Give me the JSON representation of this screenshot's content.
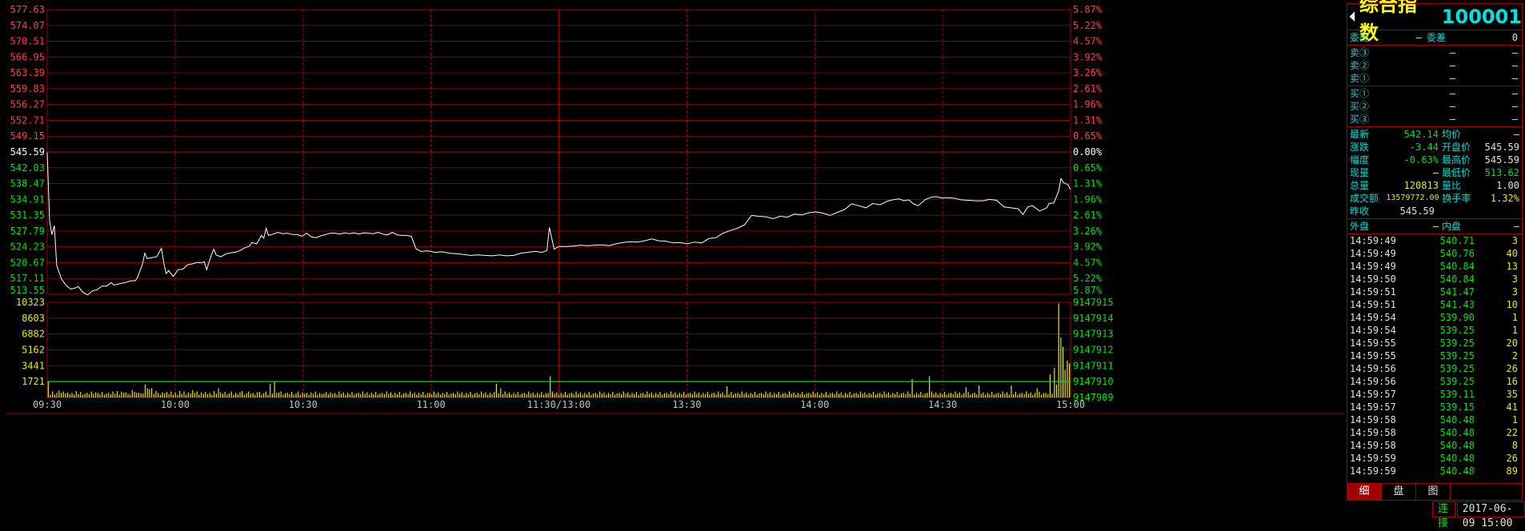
{
  "panel": {
    "name": "综合指数",
    "code": "100001",
    "ratio": {
      "label1": "委比",
      "value1": "—",
      "label2": "委差",
      "value2": "0"
    },
    "sell": [
      {
        "label": "卖③",
        "price": "—",
        "vol": "—"
      },
      {
        "label": "卖②",
        "price": "—",
        "vol": "—"
      },
      {
        "label": "卖①",
        "price": "—",
        "vol": "—"
      }
    ],
    "buy": [
      {
        "label": "买①",
        "price": "—",
        "vol": "—"
      },
      {
        "label": "买②",
        "price": "—",
        "vol": "—"
      },
      {
        "label": "买③",
        "price": "—",
        "vol": "—"
      }
    ],
    "stats": [
      {
        "l1": "最新",
        "v1": "542.14",
        "l2": "均价",
        "v2": "—"
      },
      {
        "l1": "涨跌",
        "v1": "-3.44",
        "l2": "开盘价",
        "v2": "545.59"
      },
      {
        "l1": "幅度",
        "v1": "-0.63%",
        "l2": "最高价",
        "v2": "545.59"
      },
      {
        "l1": "现量",
        "v1": "—",
        "l2": "最低价",
        "v2": "513.62"
      },
      {
        "l1": "总量",
        "v1": "120813",
        "l2": "量比",
        "v2": "1.00"
      },
      {
        "l1": "成交额",
        "v1": "13579772.00",
        "l2": "换手率",
        "v2": "1.32%"
      },
      {
        "l1": "昨收",
        "v1": "545.59",
        "l2": "",
        "v2": ""
      }
    ],
    "outer_inner": {
      "l1": "外盘",
      "v1": "—",
      "l2": "内盘",
      "v2": "—"
    },
    "ticks": [
      {
        "time": "14:59:49",
        "price": "540.71",
        "vol": "3"
      },
      {
        "time": "14:59:49",
        "price": "540.76",
        "vol": "40"
      },
      {
        "time": "14:59:49",
        "price": "540.84",
        "vol": "13"
      },
      {
        "time": "14:59:50",
        "price": "540.84",
        "vol": "3"
      },
      {
        "time": "14:59:51",
        "price": "541.47",
        "vol": "3"
      },
      {
        "time": "14:59:51",
        "price": "541.43",
        "vol": "10"
      },
      {
        "time": "14:59:54",
        "price": "539.90",
        "vol": "1"
      },
      {
        "time": "14:59:54",
        "price": "539.25",
        "vol": "1"
      },
      {
        "time": "14:59:55",
        "price": "539.25",
        "vol": "20"
      },
      {
        "time": "14:59:55",
        "price": "539.25",
        "vol": "2"
      },
      {
        "time": "14:59:56",
        "price": "539.25",
        "vol": "26"
      },
      {
        "time": "14:59:56",
        "price": "539.25",
        "vol": "16"
      },
      {
        "time": "14:59:57",
        "price": "539.11",
        "vol": "35"
      },
      {
        "time": "14:59:57",
        "price": "539.15",
        "vol": "41"
      },
      {
        "time": "14:59:58",
        "price": "540.48",
        "vol": "1"
      },
      {
        "time": "14:59:58",
        "price": "540.48",
        "vol": "22"
      },
      {
        "time": "14:59:58",
        "price": "540.48",
        "vol": "8"
      },
      {
        "time": "14:59:59",
        "price": "540.48",
        "vol": "26"
      },
      {
        "time": "14:59:59",
        "price": "540.48",
        "vol": "89"
      }
    ],
    "tabs": [
      "细",
      "盘",
      "图"
    ]
  },
  "status": {
    "connection": "连接",
    "datetime": "2017-06-09 15:00"
  },
  "colors": {
    "grid": "#a00000",
    "up": "#ff4040",
    "down": "#00e000",
    "line": "#ffffff",
    "volume": "#e8e800",
    "volume_avg": "#00e000",
    "prev_close": "#ffffff"
  },
  "chart_data": {
    "type": "line",
    "prev_close": 545.59,
    "price_axis": {
      "ylim": [
        513.55,
        577.63
      ],
      "left_ticks": [
        "577.63",
        "574.07",
        "570.51",
        "566.95",
        "563.39",
        "559.83",
        "556.27",
        "552.71",
        "549.15",
        "545.59",
        "542.03",
        "538.47",
        "534.91",
        "531.35",
        "527.79",
        "524.23",
        "520.67",
        "517.11",
        "513.55"
      ],
      "right_ticks": [
        "5.87%",
        "5.22%",
        "4.57%",
        "3.92%",
        "3.26%",
        "2.61%",
        "1.96%",
        "1.31%",
        "0.65%",
        "0.00%",
        "0.65%",
        "1.31%",
        "1.96%",
        "2.61%",
        "3.26%",
        "3.92%",
        "4.57%",
        "5.22%",
        "5.87%"
      ]
    },
    "volume_axis": {
      "left_ticks": [
        "10323",
        "8603",
        "6882",
        "5162",
        "3441",
        "1721"
      ],
      "right_ticks": [
        "9147915",
        "9147914",
        "9147913",
        "9147912",
        "9147911",
        "9147910",
        "9147909"
      ]
    },
    "x_ticks": [
      "09:30",
      "10:00",
      "10:30",
      "11:00",
      "11:30/13:00",
      "13:30",
      "14:00",
      "14:30",
      "15:00"
    ],
    "minutes_total": 240,
    "price_series": [
      [
        0,
        545.5
      ],
      [
        1,
        530
      ],
      [
        2,
        527
      ],
      [
        3,
        529
      ],
      [
        4,
        520
      ],
      [
        6,
        517
      ],
      [
        8,
        515.5
      ],
      [
        10,
        514.7
      ],
      [
        12,
        515
      ],
      [
        13,
        515.3
      ],
      [
        15,
        514
      ],
      [
        17,
        513.4
      ],
      [
        19,
        514.3
      ],
      [
        21,
        514.6
      ],
      [
        23,
        515.4
      ],
      [
        25,
        515.4
      ],
      [
        27,
        516.2
      ],
      [
        28,
        515.6
      ],
      [
        31,
        516
      ],
      [
        33,
        516.2
      ],
      [
        35,
        516.6
      ],
      [
        37,
        516.6
      ],
      [
        38,
        517.4
      ],
      [
        40,
        520.3
      ],
      [
        41,
        522.8
      ],
      [
        42,
        521.6
      ],
      [
        44,
        521.8
      ],
      [
        46,
        522
      ],
      [
        48,
        523.9
      ],
      [
        49,
        520.6
      ],
      [
        50,
        518.2
      ],
      [
        51,
        518.9
      ],
      [
        53,
        517.6
      ],
      [
        55,
        519.1
      ],
      [
        57,
        519.2
      ],
      [
        59,
        520.2
      ],
      [
        61,
        520.4
      ],
      [
        63,
        520.7
      ],
      [
        65,
        520.6
      ],
      [
        66,
        520.9
      ],
      [
        67,
        519.1
      ],
      [
        69,
        522.4
      ],
      [
        70,
        523.7
      ],
      [
        71,
        522.4
      ],
      [
        73,
        522
      ],
      [
        75,
        522.6
      ],
      [
        77,
        522.9
      ],
      [
        79,
        523
      ],
      [
        81,
        523.4
      ],
      [
        83,
        524
      ],
      [
        85,
        524.4
      ],
      [
        86,
        525.2
      ],
      [
        88,
        524.9
      ],
      [
        89,
        525.8
      ],
      [
        90,
        526.8
      ],
      [
        91,
        526.2
      ],
      [
        92,
        528.4
      ],
      [
        93,
        526.8
      ],
      [
        95,
        527.1
      ],
      [
        97,
        527.5
      ],
      [
        99,
        527.2
      ],
      [
        101,
        527.3
      ],
      [
        103,
        527
      ],
      [
        105,
        527
      ],
      [
        107,
        526.6
      ],
      [
        109,
        527.3
      ],
      [
        111,
        526.5
      ],
      [
        113,
        526.3
      ],
      [
        115,
        526.7
      ],
      [
        117,
        527
      ],
      [
        119,
        527.3
      ],
      [
        121,
        527.3
      ],
      [
        123,
        527.1
      ],
      [
        125,
        527.4
      ],
      [
        127,
        527.2
      ],
      [
        129,
        527.4
      ],
      [
        131,
        527.1
      ],
      [
        133,
        527.4
      ],
      [
        135,
        527.3
      ],
      [
        137,
        527.2
      ],
      [
        139,
        527.5
      ],
      [
        141,
        527.1
      ],
      [
        143,
        526.9
      ],
      [
        145,
        527.5
      ],
      [
        147,
        526.9
      ],
      [
        149,
        526.8
      ],
      [
        151,
        526.8
      ],
      [
        153,
        526.6
      ],
      [
        155,
        523.8
      ],
      [
        157,
        523.2
      ],
      [
        160,
        523.3
      ],
      [
        163,
        523
      ],
      [
        166,
        523.1
      ],
      [
        169,
        522.8
      ],
      [
        172,
        522.7
      ],
      [
        175,
        522.5
      ],
      [
        178,
        522.3
      ],
      [
        181,
        522.4
      ],
      [
        184,
        522.3
      ],
      [
        187,
        522.2
      ],
      [
        190,
        522.4
      ],
      [
        193,
        522.2
      ],
      [
        196,
        522.3
      ],
      [
        199,
        522.8
      ],
      [
        202,
        523
      ],
      [
        205,
        523.2
      ],
      [
        208,
        523
      ],
      [
        210,
        523.4
      ],
      [
        211,
        528.6
      ],
      [
        213,
        523.7
      ],
      [
        215,
        524.3
      ],
      [
        218,
        524.3
      ],
      [
        221,
        524.4
      ],
      [
        224,
        524.6
      ],
      [
        227,
        524.5
      ],
      [
        230,
        524.6
      ],
      [
        233,
        524.7
      ],
      [
        236,
        524.5
      ],
      [
        239,
        524.9
      ],
      [
        242,
        525.2
      ],
      [
        245,
        525.4
      ],
      [
        248,
        525.3
      ],
      [
        251,
        525.6
      ],
      [
        254,
        526
      ],
      [
        257,
        525.6
      ],
      [
        260,
        525.5
      ],
      [
        263,
        525.1
      ],
      [
        266,
        525.2
      ],
      [
        269,
        524.9
      ],
      [
        272,
        525.3
      ],
      [
        275,
        525.1
      ],
      [
        278,
        526.1
      ],
      [
        281,
        526.3
      ],
      [
        284,
        527.3
      ],
      [
        287,
        527.9
      ],
      [
        290,
        528.4
      ],
      [
        293,
        529.2
      ],
      [
        296,
        531.3
      ],
      [
        299,
        531.1
      ],
      [
        302,
        531
      ],
      [
        305,
        530.6
      ],
      [
        308,
        531.1
      ],
      [
        311,
        530.9
      ],
      [
        314,
        531.6
      ],
      [
        317,
        531.4
      ],
      [
        320,
        531.9
      ],
      [
        323,
        532.1
      ],
      [
        326,
        531.8
      ],
      [
        329,
        531.3
      ],
      [
        332,
        532
      ],
      [
        335,
        532.6
      ],
      [
        338,
        533.9
      ],
      [
        341,
        533.5
      ],
      [
        344,
        533
      ],
      [
        347,
        534
      ],
      [
        350,
        533.7
      ],
      [
        353,
        534.5
      ],
      [
        356,
        534.9
      ],
      [
        358,
        535
      ],
      [
        360,
        534.6
      ],
      [
        362,
        534.8
      ],
      [
        364,
        533.9
      ],
      [
        366,
        533.5
      ],
      [
        369,
        534.9
      ],
      [
        372,
        535.5
      ],
      [
        374,
        535.5
      ],
      [
        376,
        535.2
      ],
      [
        378,
        535.3
      ],
      [
        381,
        535.2
      ],
      [
        384,
        534.8
      ],
      [
        387,
        534.7
      ],
      [
        390,
        534.6
      ],
      [
        393,
        534.6
      ],
      [
        396,
        534.9
      ],
      [
        399,
        534.7
      ],
      [
        402,
        533.2
      ],
      [
        405,
        533
      ],
      [
        408,
        532.8
      ],
      [
        410,
        531.5
      ],
      [
        412,
        533.2
      ],
      [
        414,
        533.5
      ],
      [
        417,
        532.3
      ],
      [
        420,
        533
      ],
      [
        421,
        534
      ],
      [
        423,
        534.1
      ],
      [
        425,
        536.8
      ],
      [
        426,
        539.6
      ],
      [
        427,
        538.7
      ],
      [
        429,
        538.2
      ],
      [
        430,
        537.1
      ]
    ],
    "volume_series": {
      "ylim": [
        0,
        10323
      ],
      "avg_level": 1721,
      "values": [
        1721,
        300,
        650,
        300,
        500,
        750,
        500,
        650,
        450,
        550,
        350,
        500,
        300,
        700,
        350,
        600,
        300,
        400,
        500,
        350,
        650,
        400,
        550,
        500,
        350,
        600,
        300,
        450,
        500,
        350,
        650,
        400,
        700,
        300,
        650,
        500,
        550,
        400,
        300,
        800,
        600,
        500,
        500,
        450,
        450,
        1400,
        1000,
        900,
        1000,
        400,
        700,
        500,
        300,
        550,
        450,
        600,
        350,
        650,
        300,
        550,
        300,
        700,
        400,
        650,
        300,
        550,
        450,
        800,
        500,
        650,
        300,
        550,
        400,
        600,
        350,
        500,
        300,
        700,
        400,
        1000,
        550,
        400,
        600,
        350,
        450,
        650,
        300,
        500,
        350,
        550,
        700,
        300,
        450,
        650,
        400,
        500,
        300,
        550,
        600,
        300,
        450,
        650,
        300,
        1500,
        400,
        1700,
        500,
        550,
        650,
        300,
        450,
        500,
        350,
        600,
        300,
        450,
        650,
        300,
        550,
        400,
        500,
        300,
        550,
        400,
        650,
        300,
        500,
        350,
        450,
        600,
        350,
        550,
        400,
        500,
        300,
        650,
        400,
        550,
        300,
        500,
        350,
        600,
        300,
        450,
        500,
        350,
        650,
        400,
        550,
        300,
        500,
        350,
        600,
        300,
        450,
        500,
        350,
        650,
        400,
        550,
        300,
        500,
        350,
        600,
        300,
        450,
        500,
        350,
        650,
        400,
        550,
        300,
        500,
        350,
        600,
        300,
        450,
        500,
        350,
        650,
        400,
        550,
        300,
        500,
        350,
        600,
        300,
        450,
        500,
        350,
        650,
        400,
        550,
        300,
        500,
        350,
        600,
        300,
        450,
        500,
        350,
        650,
        400,
        550,
        300,
        500,
        350,
        600,
        1500,
        450,
        1000,
        350,
        650,
        400,
        550,
        300,
        500,
        350,
        600,
        300,
        450,
        500,
        350,
        650,
        400,
        550,
        300,
        500,
        350,
        600,
        300,
        450,
        500,
        2300,
        650,
        400,
        550,
        300,
        500,
        350,
        600,
        300,
        450,
        500,
        350,
        650,
        400,
        550,
        300,
        500,
        350,
        600,
        300,
        450,
        500,
        350,
        650,
        400,
        550,
        300,
        500,
        350,
        600,
        300,
        450,
        500,
        350,
        650,
        400,
        550,
        300,
        500,
        350,
        600,
        300,
        450,
        500,
        350,
        650,
        400,
        550,
        300,
        500,
        350,
        600,
        300,
        450,
        500,
        350,
        650,
        400,
        550,
        300,
        500,
        350,
        600,
        300,
        450,
        500,
        350,
        650,
        400,
        550,
        300,
        500,
        350,
        600,
        300,
        450,
        500,
        350,
        650,
        400,
        550,
        300,
        1200,
        350,
        600,
        300,
        450,
        500,
        350,
        650,
        400,
        550,
        300,
        500,
        350,
        600,
        300,
        450,
        500,
        350,
        650,
        400,
        550,
        300,
        500,
        350,
        600,
        300,
        450,
        500,
        350,
        650,
        400,
        550,
        300,
        500,
        350,
        600,
        300,
        450,
        500,
        350,
        650,
        400,
        550,
        300,
        500,
        350,
        600,
        300,
        450,
        500,
        350,
        650,
        400,
        550,
        300,
        500,
        350,
        600,
        300,
        450,
        500,
        350,
        650,
        400,
        550,
        300,
        500,
        350,
        600,
        300,
        450,
        500,
        350,
        650,
        400,
        550,
        300,
        500,
        350,
        600,
        300,
        450,
        500,
        350,
        650,
        400,
        2000,
        300,
        500,
        350,
        600,
        300,
        450,
        500,
        2300,
        650,
        400,
        550,
        300,
        500,
        350,
        600,
        300,
        450,
        500,
        350,
        650,
        400,
        550,
        300,
        500,
        1100,
        600,
        300,
        450,
        500,
        350,
        1300,
        400,
        550,
        300,
        500,
        350,
        600,
        300,
        450,
        500,
        350,
        650,
        400,
        550,
        300,
        1300,
        350,
        600,
        300,
        450,
        500,
        350,
        650,
        400,
        550,
        300,
        500,
        1000,
        600,
        300,
        450,
        500,
        350,
        2500,
        400,
        3200,
        1400,
        10200,
        6500,
        5500,
        3000,
        4000,
        3700
      ]
    }
  }
}
